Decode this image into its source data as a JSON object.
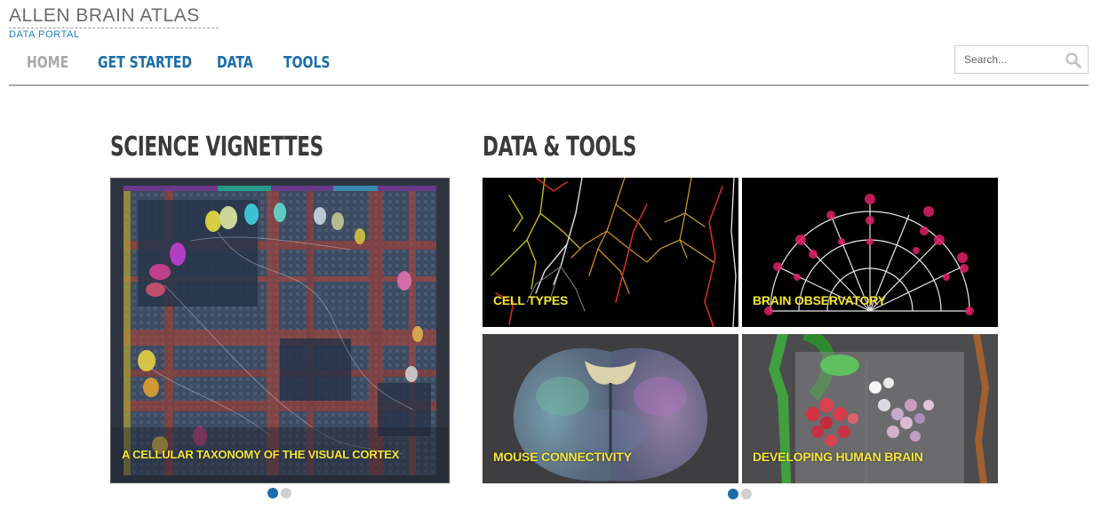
{
  "header": {
    "logo_title": "ALLEN BRAIN ATLAS",
    "logo_subtitle": "DATA PORTAL",
    "nav": [
      {
        "label": "HOME",
        "active": true
      },
      {
        "label": "GET STARTED",
        "active": false
      },
      {
        "label": "DATA",
        "active": false
      },
      {
        "label": "TOOLS",
        "active": false
      }
    ],
    "search": {
      "placeholder": "Search...",
      "value": "",
      "icon": "search-icon"
    }
  },
  "vignettes": {
    "title": "SCIENCE VIGNETTES",
    "slide_label": "A CELLULAR TAXONOMY OF THE VISUAL CORTEX",
    "carousel": {
      "count": 2,
      "active_index": 0
    }
  },
  "data_tools": {
    "title": "DATA & TOOLS",
    "tiles": [
      {
        "label": "CELL TYPES"
      },
      {
        "label": "BRAIN OBSERVATORY"
      },
      {
        "label": "MOUSE CONNECTIVITY"
      },
      {
        "label": "DEVELOPING HUMAN BRAIN"
      }
    ],
    "carousel": {
      "count": 2,
      "active_index": 0
    }
  },
  "colors": {
    "brand_blue": "#1a6ea8",
    "nav_inactive": "#a8a8a8",
    "tile_label": "#f5e63a"
  }
}
